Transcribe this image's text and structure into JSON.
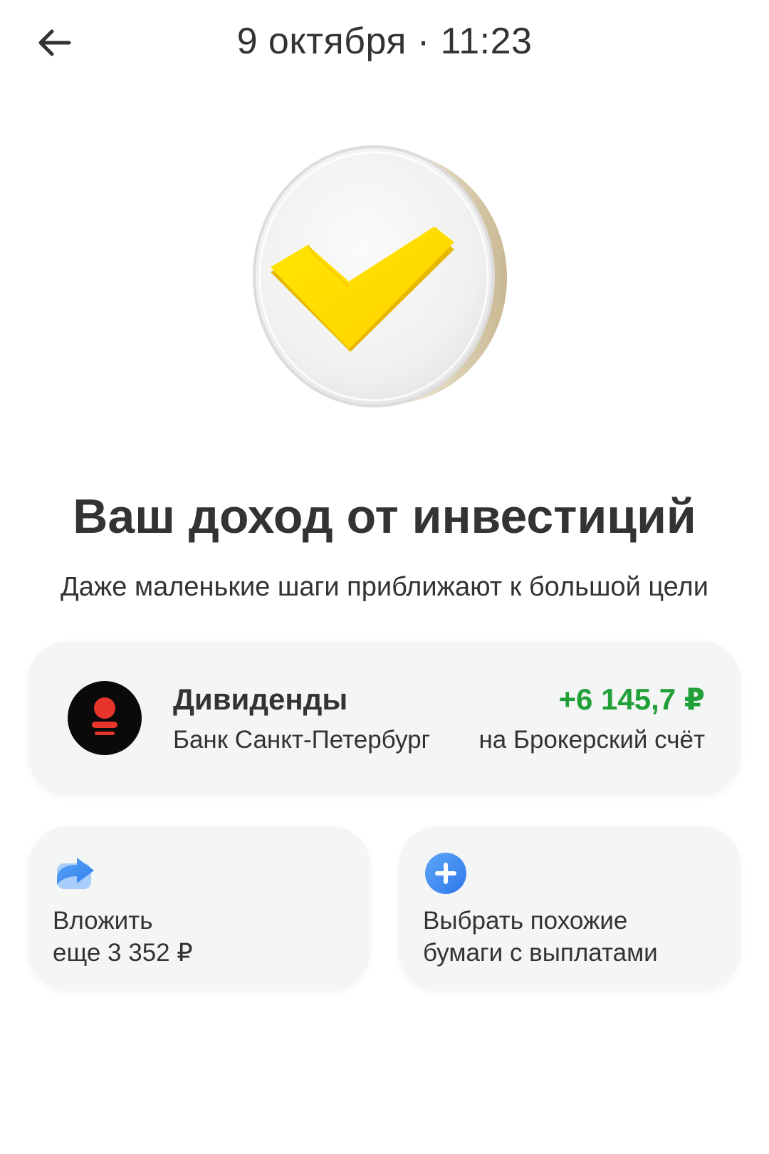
{
  "header": {
    "title": "9 октября · 11:23",
    "back_icon": "arrow-left-icon"
  },
  "hero": {
    "icon": "yellow-checkmark-coin",
    "colors": {
      "check": "#ffd900",
      "coin": "#f2f2f2"
    }
  },
  "headline": "Ваш доход от инвестиций",
  "subline": "Даже маленькие шаги приближают к большой цели",
  "dividend": {
    "title": "Дивиденды",
    "amount": "+6 145,7 ₽",
    "source": "Банк Санкт-Петербург",
    "target": "на Брокерский счёт",
    "logo_icon": "bank-logo-icon",
    "amount_color": "#21a038"
  },
  "actions": [
    {
      "icon": "share-arrow-icon",
      "line1": "Вложить",
      "line2": "еще 3 352 ₽"
    },
    {
      "icon": "plus-circle-icon",
      "line1": "Выбрать похожие",
      "line2": "бумаги с выплатами"
    }
  ]
}
